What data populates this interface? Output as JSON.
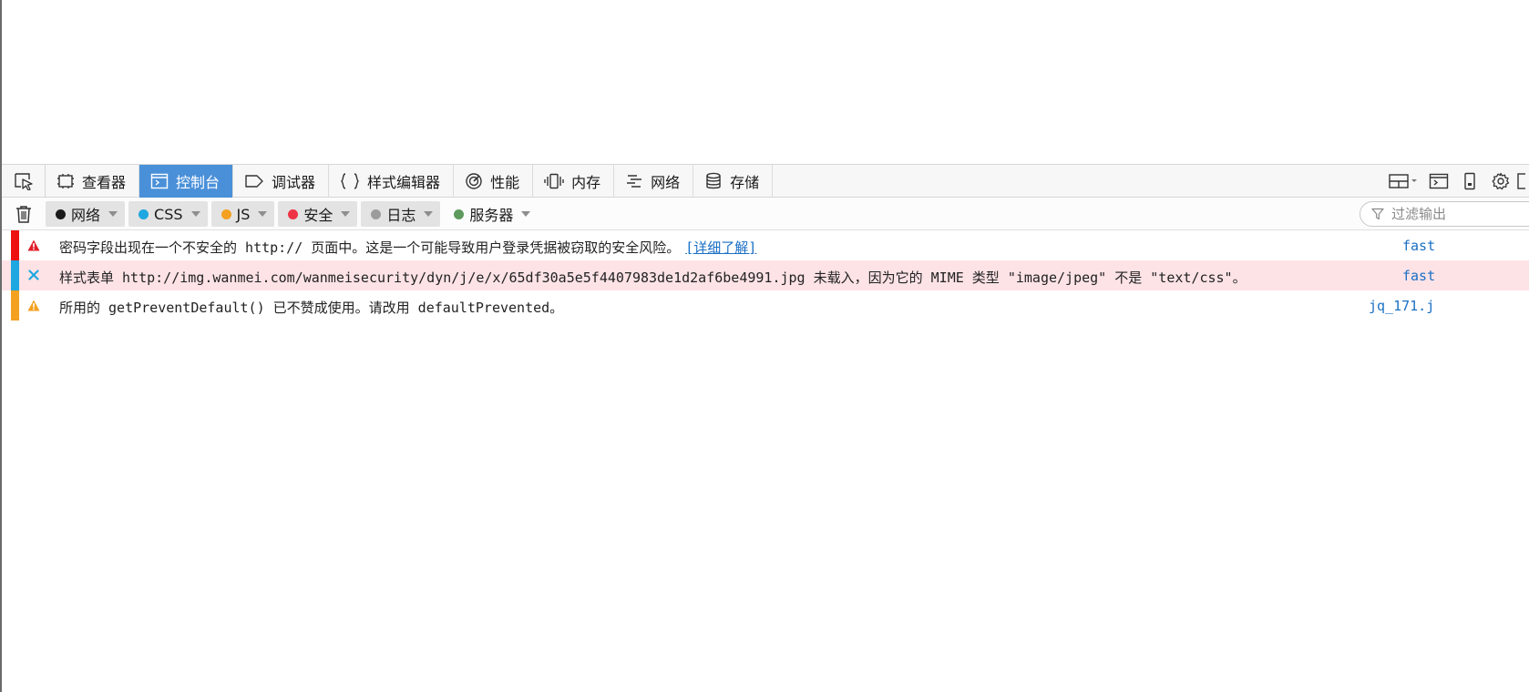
{
  "toolbar": {
    "tabs": [
      {
        "label": "查看器",
        "icon": "inspector-icon"
      },
      {
        "label": "控制台",
        "icon": "console-icon"
      },
      {
        "label": "调试器",
        "icon": "debugger-icon"
      },
      {
        "label": "样式编辑器",
        "icon": "style-editor-icon"
      },
      {
        "label": "性能",
        "icon": "performance-icon"
      },
      {
        "label": "内存",
        "icon": "memory-icon"
      },
      {
        "label": "网络",
        "icon": "network-icon"
      },
      {
        "label": "存储",
        "icon": "storage-icon"
      }
    ],
    "selected_tab": "控制台",
    "selected_color": "#4a90d9"
  },
  "filters": {
    "categories": [
      {
        "label": "网络",
        "color": "#1a1a1a"
      },
      {
        "label": "CSS",
        "color": "#1ea7e0"
      },
      {
        "label": "JS",
        "color": "#f4a020"
      },
      {
        "label": "安全",
        "color": "#ee3344"
      },
      {
        "label": "日志",
        "color": "#9c9c9c"
      },
      {
        "label": "服务器",
        "color": "#5d9a5d"
      }
    ],
    "search_placeholder": "过滤输出"
  },
  "messages": [
    {
      "type": "security",
      "bar_color": "#ee1111",
      "text": "密码字段出现在一个不安全的 http:// 页面中。这是一个可能导致用户登录凭据被窃取的安全风险。",
      "link": "[详细了解]",
      "source": "fast"
    },
    {
      "type": "css-error",
      "bar_color": "#1ea7e0",
      "text": "样式表单 http://img.wanmei.com/wanmeisecurity/dyn/j/e/x/65df30a5e5f4407983de1d2af6be4991.jpg 未载入，因为它的 MIME 类型 \"image/jpeg\" 不是 \"text/css\"。",
      "link": "",
      "source": "fast"
    },
    {
      "type": "js-warning",
      "bar_color": "#f4a020",
      "text": "所用的 getPreventDefault() 已不赞成使用。请改用 defaultPrevented。",
      "link": "",
      "source": "jq_171.j"
    }
  ]
}
